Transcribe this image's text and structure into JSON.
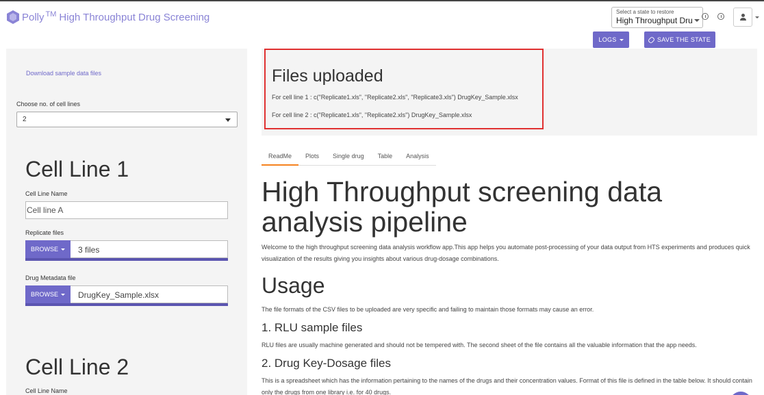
{
  "header": {
    "brand_name": "Polly",
    "brand_tm": "TM",
    "app_title": "High Throughput Drug Screening",
    "state_label": "Select a state to restore",
    "state_value": "High Throughput Dru..."
  },
  "actions": {
    "logs_label": "LOGS",
    "save_label": "SAVE THE STATE"
  },
  "sidebar": {
    "download_link": "Download sample data files",
    "cell_lines_label": "Choose no. of cell lines",
    "cell_lines_value": "2",
    "cell_line_1": {
      "heading": "Cell Line 1",
      "name_label": "Cell Line Name",
      "name_value": "Cell line A",
      "replicate_label": "Replicate files",
      "replicate_browse": "BROWSE",
      "replicate_value": "3 files",
      "replicate_progress": 1.0,
      "metadata_label": "Drug Metadata file",
      "metadata_browse": "BROWSE",
      "metadata_value": "DrugKey_Sample.xlsx",
      "metadata_progress": 1.0
    },
    "cell_line_2": {
      "heading": "Cell Line 2",
      "name_label": "Cell Line Name"
    }
  },
  "files_uploaded": {
    "title": "Files uploaded",
    "line1": "For cell line 1 : c(\"Replicate1.xls\", \"Replicate2.xls\", \"Replicate3.xls\") DrugKey_Sample.xlsx",
    "line2": "For cell line 2 : c(\"Replicate1.xls\", \"Replicate2.xls\") DrugKey_Sample.xlsx"
  },
  "tabs": [
    {
      "label": "ReadMe",
      "active": true
    },
    {
      "label": "Plots",
      "active": false
    },
    {
      "label": "Single drug",
      "active": false
    },
    {
      "label": "Table",
      "active": false
    },
    {
      "label": "Analysis",
      "active": false
    }
  ],
  "readme": {
    "title": "High Throughput screening data analysis pipeline",
    "intro": "Welcome to the high throughput screening data analysis workflow app.This app helps you automate post-processing of your data output from HTS experiments and produces quick visualization of the results giving you insights about various drug-dosage combinations.",
    "usage_heading": "Usage",
    "usage_text": "The file formats of the CSV files to be uploaded are very specific and failing to maintain those formats may cause an error.",
    "rlu_heading": "1. RLU sample files",
    "rlu_text": "RLU files are usually machine generated and should not be tempered with. The second sheet of the file contains all the valuable information that the app needs.",
    "drugkey_heading": "2. Drug Key-Dosage files",
    "drugkey_text": "This is a spreadsheet which has the information pertaining to the names of the drugs and their concentration values. Format of this file is defined in the table below. It should contain only the drugs from one library i.e. for 40 drugs."
  },
  "colors": {
    "accent": "#6f69c9",
    "tab_active": "#f5821f",
    "highlight_box": "#e03030"
  }
}
